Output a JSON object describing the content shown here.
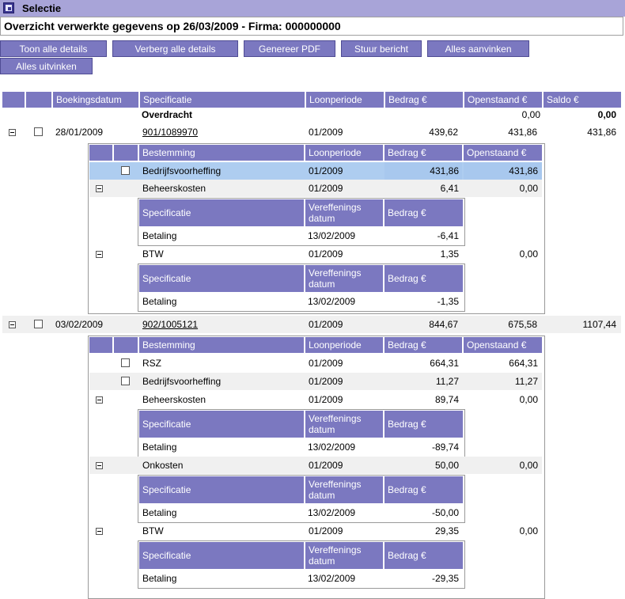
{
  "title": "Selectie",
  "subtitle": "Overzicht verwerkte gegevens op 26/03/2009 - Firma: 000000000",
  "buttons": {
    "toon": "Toon alle details",
    "verberg": "Verberg alle details",
    "pdf": "Genereer PDF",
    "stuur": "Stuur bericht",
    "aanvinken": "Alles aanvinken",
    "uitvinken": "Alles uitvinken"
  },
  "main_headers": [
    "Boekingsdatum",
    "Specificatie",
    "Loonperiode",
    "Bedrag €",
    "Openstaand €",
    "Saldo €"
  ],
  "overdracht": {
    "label": "Overdracht",
    "openstaand": "0,00",
    "saldo": "0,00"
  },
  "sub_headers": [
    "Bestemming",
    "Loonperiode",
    "Bedrag €",
    "Openstaand €"
  ],
  "detail_headers": [
    "Specificatie",
    "Vereffenings datum",
    "Bedrag €"
  ],
  "entries": [
    {
      "date": "28/01/2009",
      "spec": "901/1089970",
      "period": "01/2009",
      "amount": "439,62",
      "open": "431,86",
      "saldo": "431,86",
      "lines": [
        {
          "dest": "Bedrijfsvoorheffing",
          "period": "01/2009",
          "amount": "431,86",
          "open": "431,86"
        },
        {
          "dest": "Beheerskosten",
          "period": "01/2009",
          "amount": "6,41",
          "open": "0,00",
          "detail": {
            "spec": "Betaling",
            "date": "13/02/2009",
            "amount": "-6,41"
          }
        },
        {
          "dest": "BTW",
          "period": "01/2009",
          "amount": "1,35",
          "open": "0,00",
          "detail": {
            "spec": "Betaling",
            "date": "13/02/2009",
            "amount": "-1,35"
          }
        }
      ]
    },
    {
      "date": "03/02/2009",
      "spec": "902/1005121",
      "period": "01/2009",
      "amount": "844,67",
      "open": "675,58",
      "saldo": "1107,44",
      "lines": [
        {
          "dest": "RSZ",
          "period": "01/2009",
          "amount": "664,31",
          "open": "664,31"
        },
        {
          "dest": "Bedrijfsvoorheffing",
          "period": "01/2009",
          "amount": "11,27",
          "open": "11,27"
        },
        {
          "dest": "Beheerskosten",
          "period": "01/2009",
          "amount": "89,74",
          "open": "0,00",
          "detail": {
            "spec": "Betaling",
            "date": "13/02/2009",
            "amount": "-89,74"
          }
        },
        {
          "dest": "Onkosten",
          "period": "01/2009",
          "amount": "50,00",
          "open": "0,00",
          "detail": {
            "spec": "Betaling",
            "date": "13/02/2009",
            "amount": "-50,00"
          }
        },
        {
          "dest": "BTW",
          "period": "01/2009",
          "amount": "29,35",
          "open": "0,00",
          "detail": {
            "spec": "Betaling",
            "date": "13/02/2009",
            "amount": "-29,35"
          }
        }
      ]
    }
  ]
}
